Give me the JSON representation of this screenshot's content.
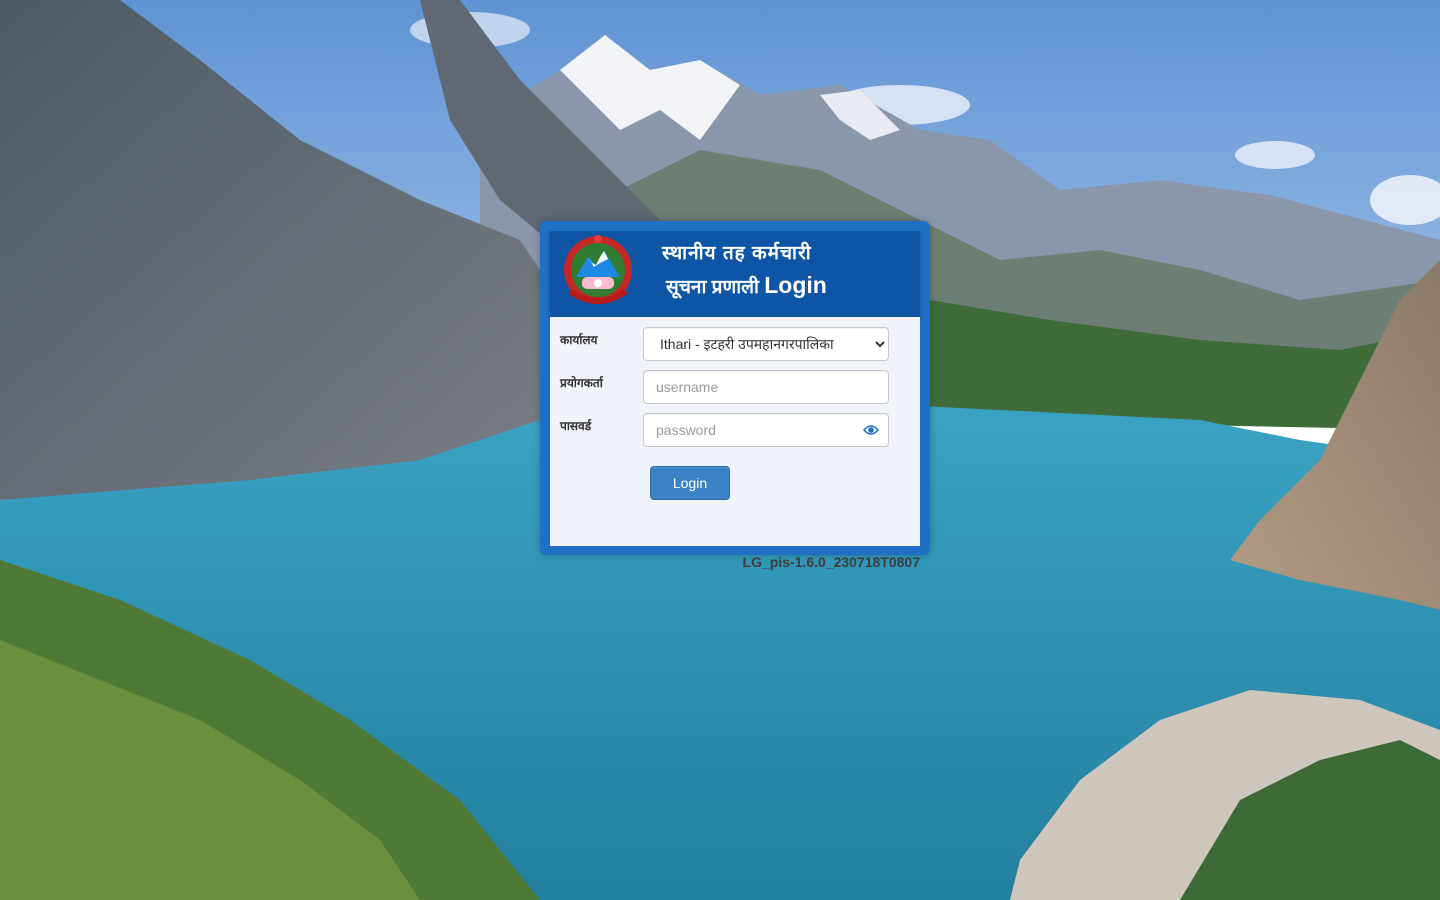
{
  "background": {
    "description_icon": "mountain-lake-landscape-image",
    "colors": {
      "sky": "#6f9fd8",
      "lake": "#2b8fb0",
      "mountain": "#6b7687",
      "forest": "#3f6b3a"
    }
  },
  "header": {
    "emblem_icon": "nepal-government-emblem-icon",
    "title_line1": "स्थानीय तह कर्मचारी",
    "title_line2_prefix": "सूचना प्रणाली",
    "title_line2_login": "Login",
    "color": "#0f55a6"
  },
  "form": {
    "office_label": "कार्यालय",
    "office_selected": "Ithari - इटहरी उपमहानगरपालिका",
    "username_label": "प्रयोगकर्ता",
    "username_placeholder": "username",
    "password_label": "पासवर्ड",
    "password_placeholder": "password",
    "password_toggle_icon": "eye-icon",
    "login_button": "Login",
    "button_color": "#3b82c6"
  },
  "footer": {
    "version": "LG_pis-1.6.0_230718T0807"
  }
}
